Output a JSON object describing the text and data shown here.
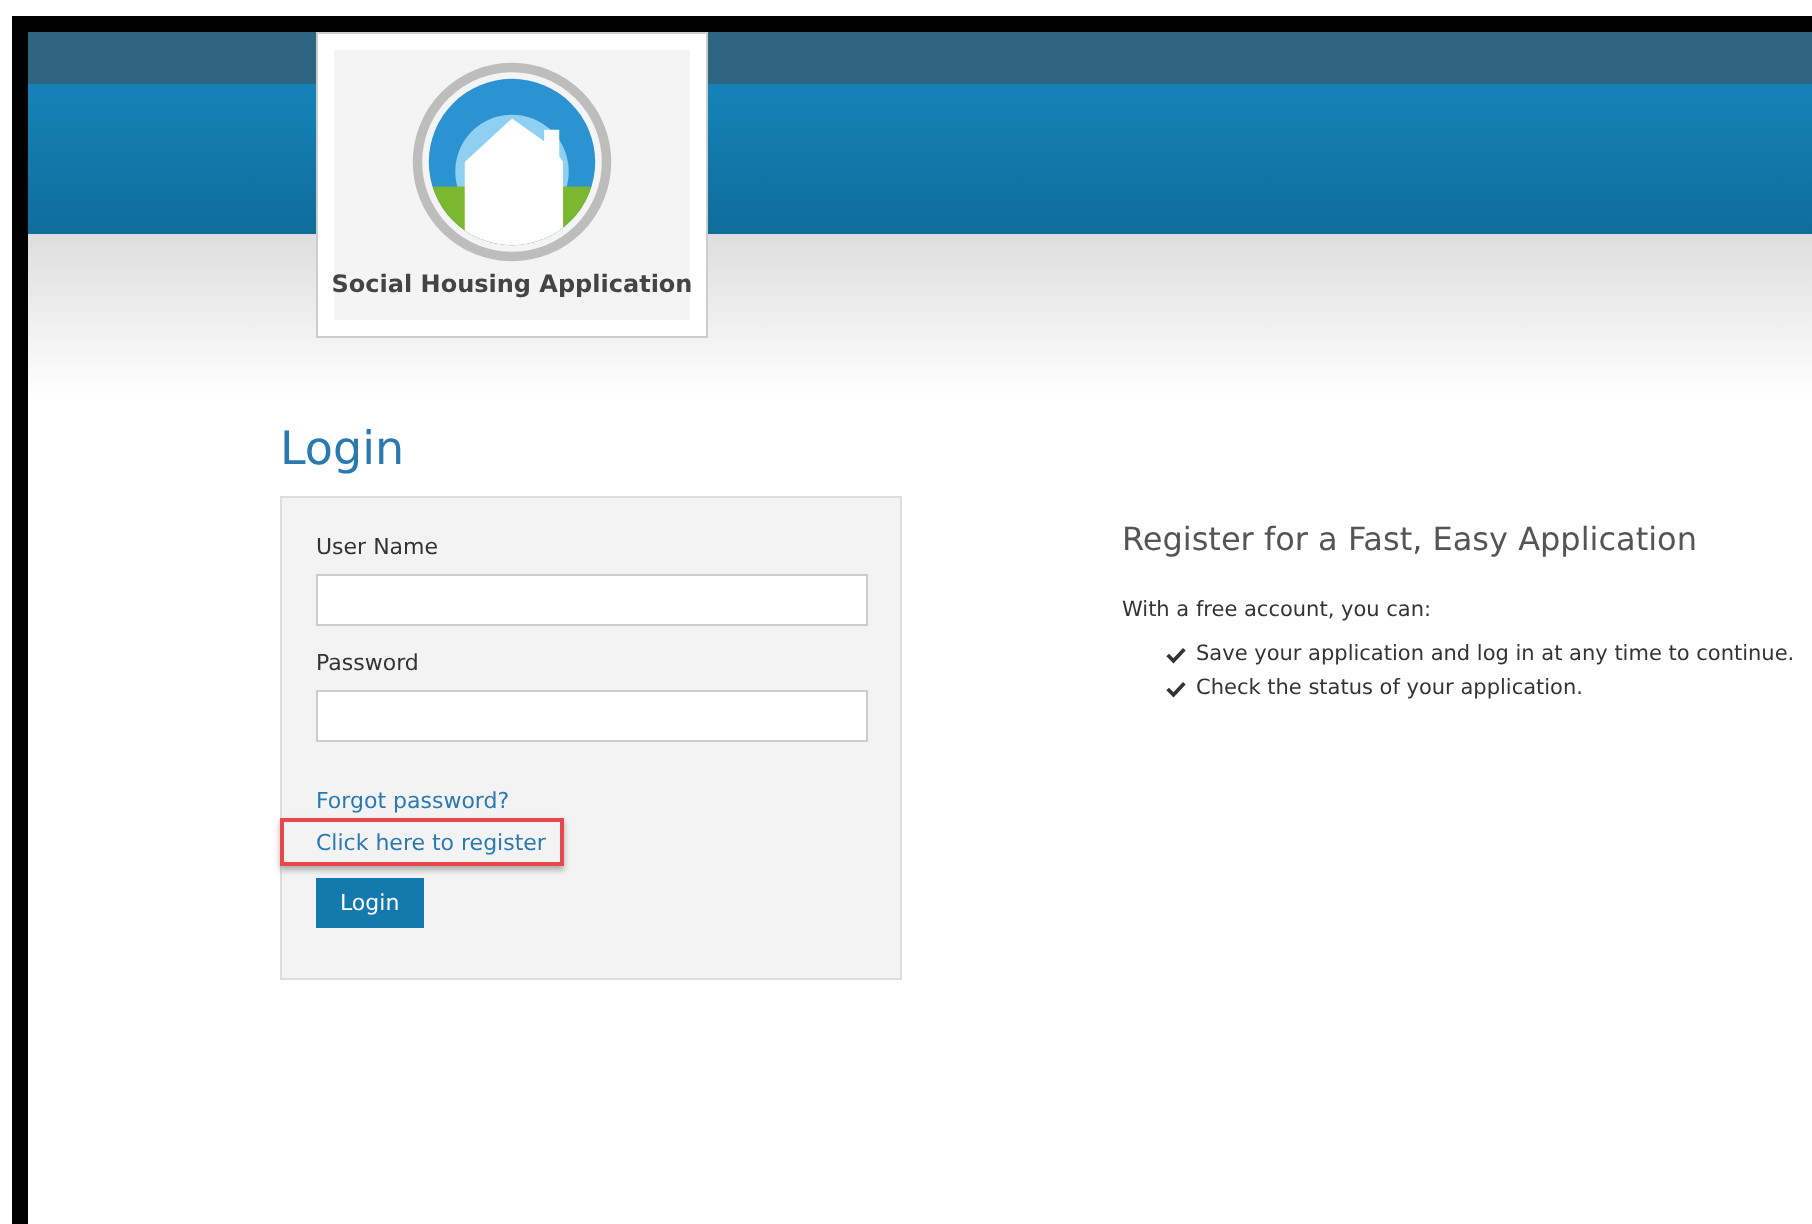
{
  "logo": {
    "caption": "Social Housing Application"
  },
  "login": {
    "title": "Login",
    "fields": [
      {
        "label": "User Name"
      },
      {
        "label": "Password"
      }
    ],
    "links": [
      {
        "text": "Forgot password?",
        "highlighted": false
      },
      {
        "text": "Click here to register",
        "highlighted": true
      }
    ],
    "button": "Login"
  },
  "register": {
    "title": "Register for a Fast, Easy Application",
    "intro": "With a free account, you can:",
    "benefits": [
      "Save your application and log in at any time to continue.",
      "Check the status of your application."
    ]
  }
}
